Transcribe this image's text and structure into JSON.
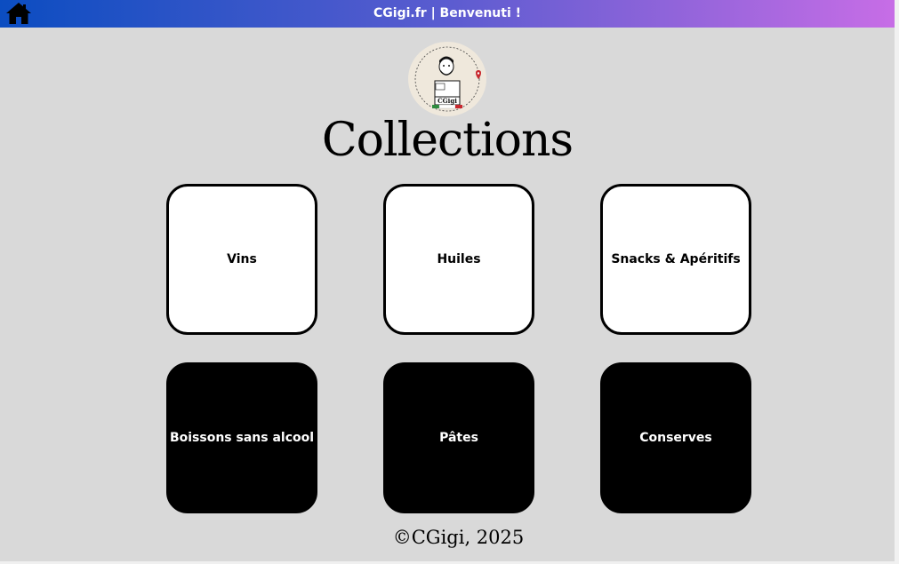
{
  "header": {
    "title": "CGigi.fr | Benvenuti !",
    "home_icon": "home-icon"
  },
  "logo": {
    "name": "cgigi-logo"
  },
  "page": {
    "title": "Collections"
  },
  "collections": [
    {
      "label": "Vins",
      "style": "light"
    },
    {
      "label": "Huiles",
      "style": "light"
    },
    {
      "label": "Snacks & Apéritifs",
      "style": "light"
    },
    {
      "label": "Boissons sans alcool",
      "style": "dark"
    },
    {
      "label": "Pâtes",
      "style": "dark"
    },
    {
      "label": "Conserves",
      "style": "dark"
    }
  ],
  "footer": {
    "copyright": "©CGigi, 2025"
  },
  "colors": {
    "background": "#d9d9d9",
    "header_gradient_start": "#0b4dc1",
    "header_gradient_end": "#c76de6",
    "card_light": "#ffffff",
    "card_dark": "#000000"
  }
}
